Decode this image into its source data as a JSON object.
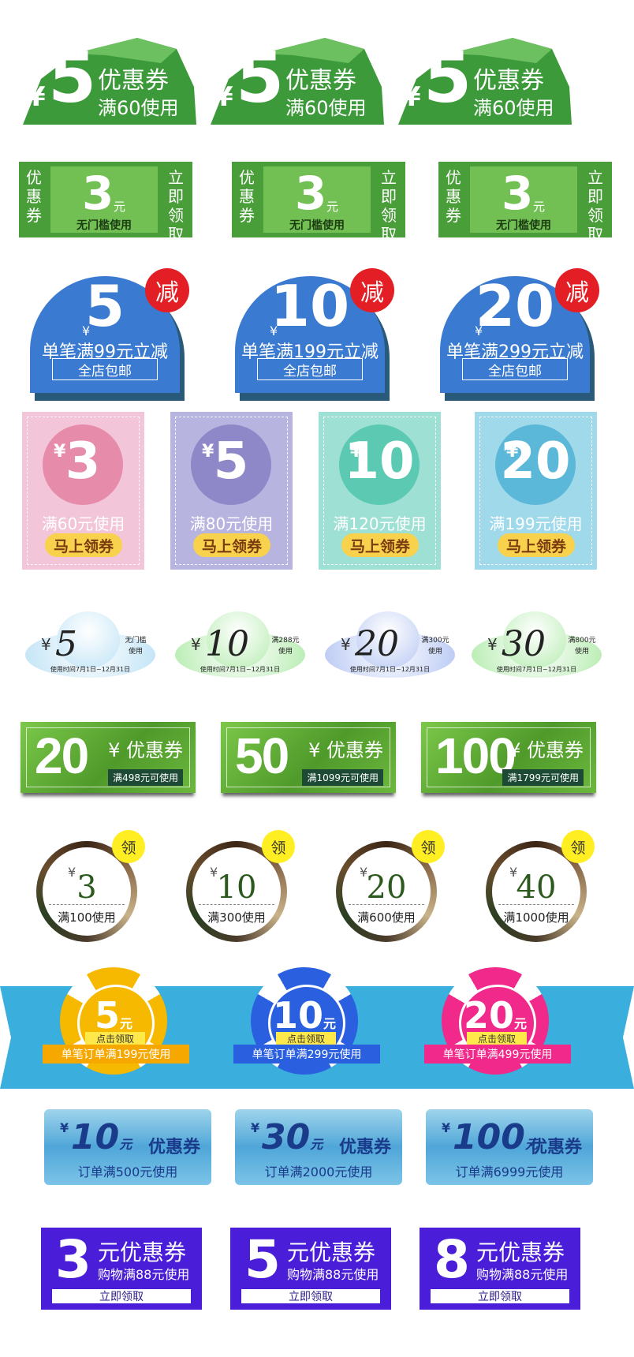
{
  "rock_coupons": [
    {
      "yen": "¥",
      "amount": "5",
      "label": "优惠券",
      "condition": "满60使用"
    },
    {
      "yen": "¥",
      "amount": "5",
      "label": "优惠券",
      "condition": "满60使用"
    },
    {
      "yen": "¥",
      "amount": "5",
      "label": "优惠券",
      "condition": "满60使用"
    }
  ],
  "ticket_coupons": [
    {
      "left": "优惠券",
      "amount": "3",
      "unit": "元",
      "condition": "无门槛使用",
      "right": "立即领取"
    },
    {
      "left": "优惠券",
      "amount": "3",
      "unit": "元",
      "condition": "无门槛使用",
      "right": "立即领取"
    },
    {
      "left": "优惠券",
      "amount": "3",
      "unit": "元",
      "condition": "无门槛使用",
      "right": "立即领取"
    }
  ],
  "dome_coupons": [
    {
      "yen": "¥",
      "amount": "5",
      "badge": "减",
      "condition": "单笔满99元立减",
      "note": "全店包邮"
    },
    {
      "yen": "¥",
      "amount": "10",
      "badge": "减",
      "condition": "单笔满199元立减",
      "note": "全店包邮"
    },
    {
      "yen": "¥",
      "amount": "20",
      "badge": "减",
      "condition": "单笔满299元立减",
      "note": "全店包邮"
    }
  ],
  "pastel_coupons": [
    {
      "yen": "¥",
      "amount": "3",
      "condition": "满60元使用",
      "button": "马上领券",
      "bg": "#f2c5d8",
      "circle": "#e78bab"
    },
    {
      "yen": "¥",
      "amount": "5",
      "condition": "满80元使用",
      "button": "马上领券",
      "bg": "#b8b4e0",
      "circle": "#8e88c8"
    },
    {
      "yen": "¥",
      "amount": "10",
      "condition": "满120元使用",
      "button": "马上领券",
      "bg": "#9fe0d4",
      "circle": "#5ccab2"
    },
    {
      "yen": "¥",
      "amount": "20",
      "condition": "满199元使用",
      "button": "马上领券",
      "bg": "#9fd9ea",
      "circle": "#5cb8d8"
    }
  ],
  "cloud_coupons": [
    {
      "yen": "¥",
      "amount": "5",
      "cond1": "无门槛",
      "cond2": "使用",
      "date": "使用时间7月1日~12月31日",
      "tint": "#bfe3f6"
    },
    {
      "yen": "¥",
      "amount": "10",
      "cond1": "满288元",
      "cond2": "使用",
      "date": "使用时间7月1日~12月31日",
      "tint": "#b6ecb0"
    },
    {
      "yen": "¥",
      "amount": "20",
      "cond1": "满300元",
      "cond2": "使用",
      "date": "使用时间7月1日~12月31日",
      "tint": "#b8c8f4"
    },
    {
      "yen": "¥",
      "amount": "30",
      "cond1": "满800元",
      "cond2": "使用",
      "date": "使用时间7月1日~12月31日",
      "tint": "#b6ecb0"
    }
  ],
  "green_coupons": [
    {
      "amount": "20",
      "label": "¥ 优惠券",
      "condition": "满498元可使用"
    },
    {
      "amount": "50",
      "label": "¥ 优惠券",
      "condition": "满1099元可使用"
    },
    {
      "amount": "100",
      "label": "¥ 优惠券",
      "condition": "满1799元可使用"
    }
  ],
  "ring_coupons": [
    {
      "yen": "¥",
      "amount": "3",
      "condition": "满100使用",
      "badge": "领"
    },
    {
      "yen": "¥",
      "amount": "10",
      "condition": "满300使用",
      "badge": "领"
    },
    {
      "yen": "¥",
      "amount": "20",
      "condition": "满600使用",
      "badge": "领"
    },
    {
      "yen": "¥",
      "amount": "40",
      "condition": "满1000使用",
      "badge": "领"
    }
  ],
  "chip_coupons": [
    {
      "amount": "5",
      "unit": "元",
      "click": "点击领取",
      "condition": "单笔订单满199元使用",
      "color": "#f7b800",
      "bar": "#f7a800"
    },
    {
      "amount": "10",
      "unit": "元",
      "click": "点击领取",
      "condition": "单笔订单满299元使用",
      "color": "#2a5fe0",
      "bar": "#2a5fe0"
    },
    {
      "amount": "20",
      "unit": "元",
      "click": "点击领取",
      "condition": "单笔订单满499元使用",
      "color": "#f0298a",
      "bar": "#f0298a"
    }
  ],
  "ice_coupons": [
    {
      "yen": "¥",
      "amount": "10",
      "unit": "元",
      "label": "优惠券",
      "condition": "订单满500元使用"
    },
    {
      "yen": "¥",
      "amount": "30",
      "unit": "元",
      "label": "优惠券",
      "condition": "订单满2000元使用"
    },
    {
      "yen": "¥",
      "amount": "100",
      "unit": "元",
      "label": "优惠券",
      "condition": "订单满6999元使用"
    }
  ],
  "purple_coupons": [
    {
      "amount": "3",
      "label": "元优惠券",
      "condition": "购物满88元使用",
      "button": "立即领取"
    },
    {
      "amount": "5",
      "label": "元优惠券",
      "condition": "购物满88元使用",
      "button": "立即领取"
    },
    {
      "amount": "8",
      "label": "元优惠券",
      "condition": "购物满88元使用",
      "button": "立即领取"
    }
  ],
  "colors": {
    "band": "#3aaedc",
    "rock": "#3d9a3a",
    "ticket_dark": "#4a9e3a"
  }
}
